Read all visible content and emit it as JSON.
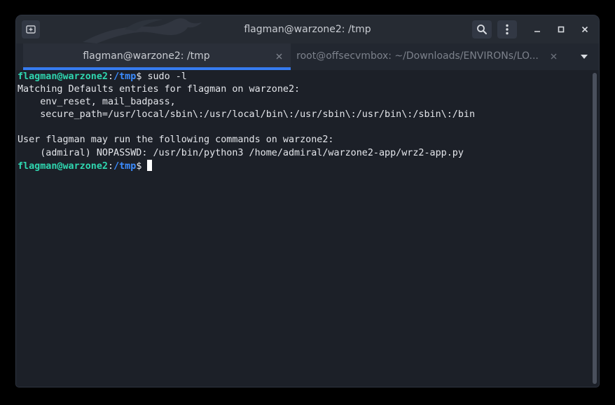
{
  "window": {
    "title": "flagman@warzone2: /tmp"
  },
  "tabs": [
    {
      "label": "flagman@warzone2: /tmp",
      "active": true
    },
    {
      "label": "root@offsecvmbox: ~/Downloads/ENVIRONs/LO...",
      "active": false
    }
  ],
  "icons": {
    "new_tab": "new-tab-icon",
    "search": "search-icon",
    "menu": "kebab-menu-icon",
    "minimize": "minimize-icon",
    "maximize": "maximize-icon",
    "close": "close-icon",
    "tab_close": "close-icon",
    "tab_list": "chevron-down-icon"
  },
  "colors": {
    "accent": "#367bf0",
    "prompt_user": "#2fd6b0",
    "prompt_path": "#3c8cff",
    "background": "#1c2028"
  },
  "terminal": {
    "prompt": {
      "user_host": "flagman@warzone2",
      "colon": ":",
      "path": "/tmp",
      "symbol": "$ "
    },
    "command_1": "sudo -l",
    "output": [
      "Matching Defaults entries for flagman on warzone2:",
      "    env_reset, mail_badpass,",
      "    secure_path=/usr/local/sbin\\:/usr/local/bin\\:/usr/sbin\\:/usr/bin\\:/sbin\\:/bin",
      "",
      "User flagman may run the following commands on warzone2:",
      "    (admiral) NOPASSWD: /usr/bin/python3 /home/admiral/warzone2-app/wrz2-app.py"
    ]
  }
}
